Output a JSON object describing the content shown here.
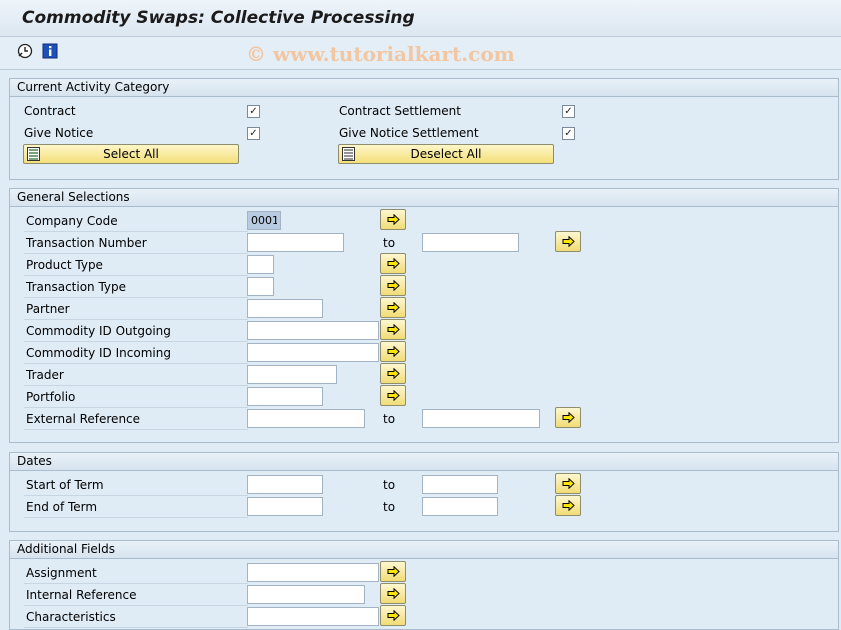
{
  "window": {
    "title": "Commodity Swaps: Collective Processing"
  },
  "toolbar": {
    "watermark": "© www.tutorialkart.com",
    "icons": [
      "execute-clock-icon",
      "info-icon"
    ]
  },
  "activity": {
    "header": "Current Activity Category",
    "contract_label": "Contract",
    "contract_settlement_label": "Contract Settlement",
    "give_notice_label": "Give Notice",
    "give_notice_settlement_label": "Give Notice Settlement",
    "contract_checked": true,
    "contract_settlement_checked": true,
    "give_notice_checked": true,
    "give_notice_settlement_checked": true,
    "check_mark": "✓",
    "select_all_label": "Select All",
    "deselect_all_label": "Deselect All"
  },
  "general": {
    "header": "General Selections",
    "to_label": "to",
    "rows": {
      "company_code": {
        "label": "Company Code",
        "value": "0001"
      },
      "transaction_number": {
        "label": "Transaction Number",
        "value": "",
        "to_value": ""
      },
      "product_type": {
        "label": "Product Type",
        "value": ""
      },
      "transaction_type": {
        "label": "Transaction Type",
        "value": ""
      },
      "partner": {
        "label": "Partner",
        "value": ""
      },
      "commodity_out": {
        "label": "Commodity ID Outgoing",
        "value": ""
      },
      "commodity_in": {
        "label": "Commodity ID Incoming",
        "value": ""
      },
      "trader": {
        "label": "Trader",
        "value": ""
      },
      "portfolio": {
        "label": "Portfolio",
        "value": ""
      },
      "external_ref": {
        "label": "External Reference",
        "value": "",
        "to_value": ""
      }
    }
  },
  "dates": {
    "header": "Dates",
    "to_label": "to",
    "start_label": "Start of Term",
    "end_label": "End of Term",
    "start_from": "",
    "start_to": "",
    "end_from": "",
    "end_to": ""
  },
  "additional": {
    "header": "Additional Fields",
    "assignment_label": "Assignment",
    "internal_ref_label": "Internal Reference",
    "characteristics_label": "Characteristics",
    "assignment_value": "",
    "internal_ref_value": "",
    "characteristics_value": ""
  }
}
